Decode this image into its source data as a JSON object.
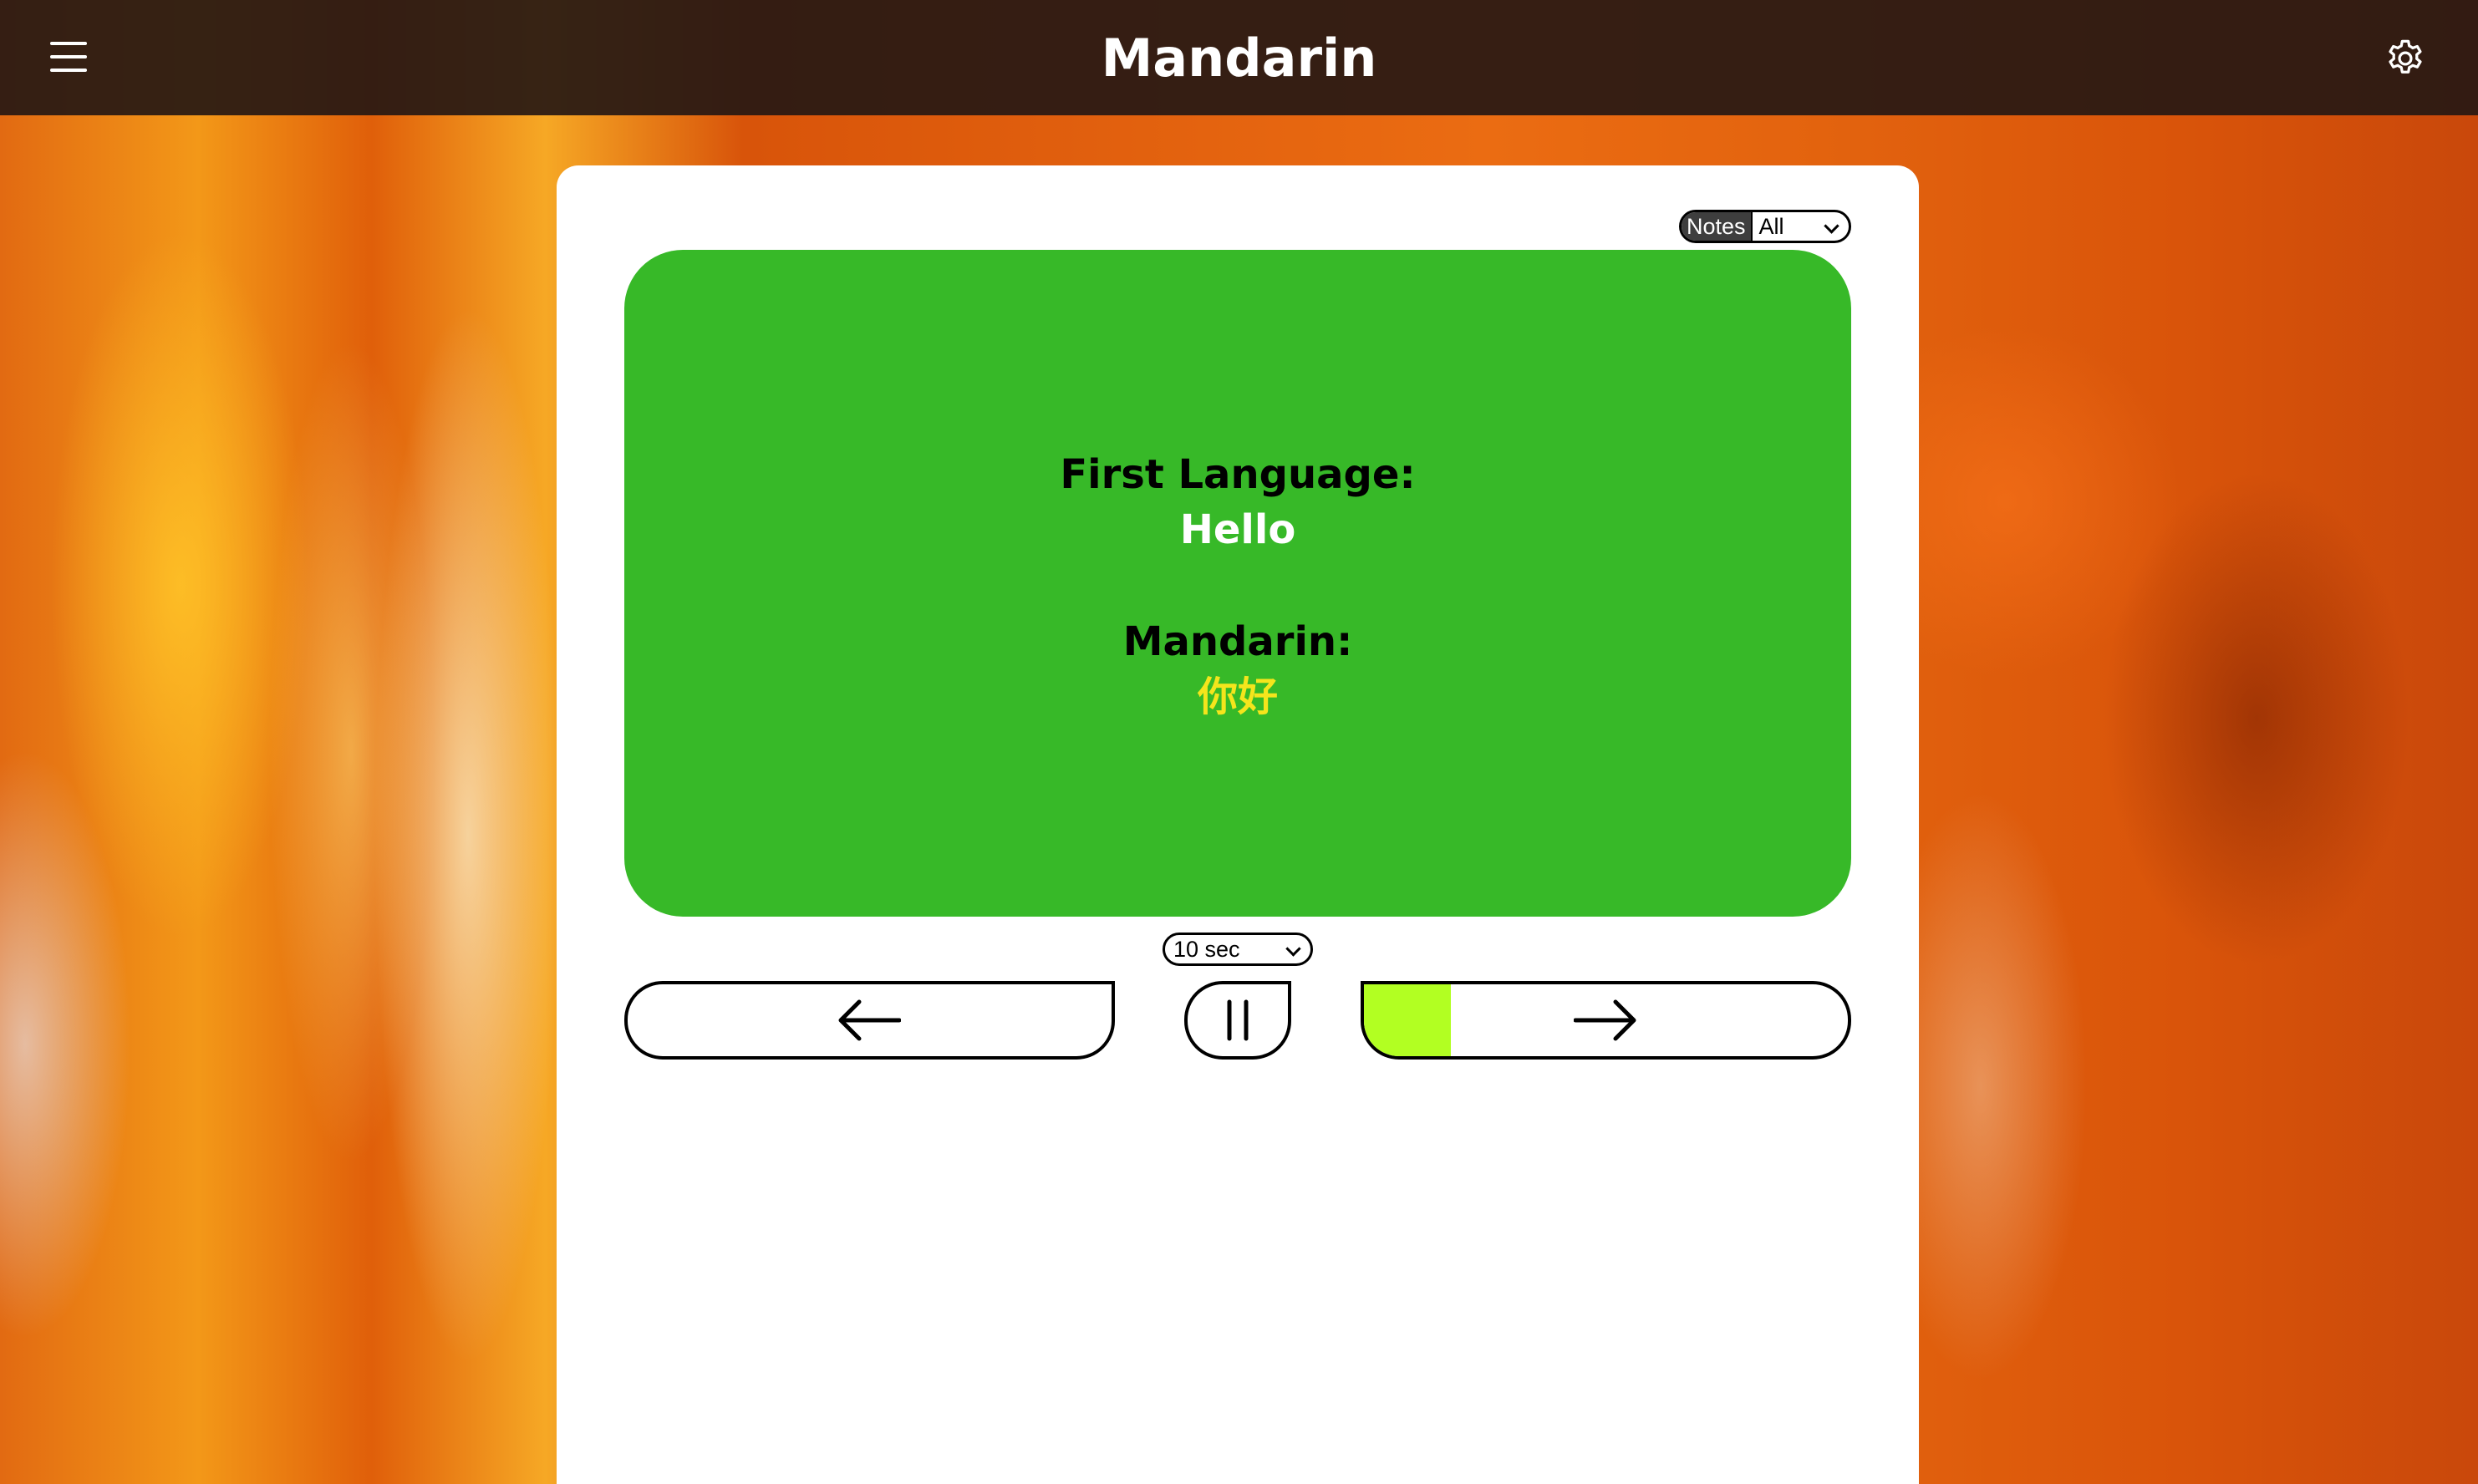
{
  "header": {
    "title": "Mandarin",
    "menu_icon": "hamburger-menu-icon",
    "settings_icon": "gear-icon"
  },
  "notes_filter": {
    "label": "Notes",
    "selected": "All"
  },
  "card": {
    "first_language_label": "First Language:",
    "first_language_value": "Hello",
    "target_language_label": "Mandarin:",
    "target_language_value": "你好",
    "background_color": "#37b928",
    "first_value_color": "#ffffff",
    "target_value_color": "#f4e51c"
  },
  "timer": {
    "selected": "10 sec"
  },
  "controls": {
    "prev_icon": "arrow-left-icon",
    "pause_icon": "pause-icon",
    "next_icon": "arrow-right-icon",
    "next_progress": 0.18,
    "progress_color": "#b2ff22"
  }
}
